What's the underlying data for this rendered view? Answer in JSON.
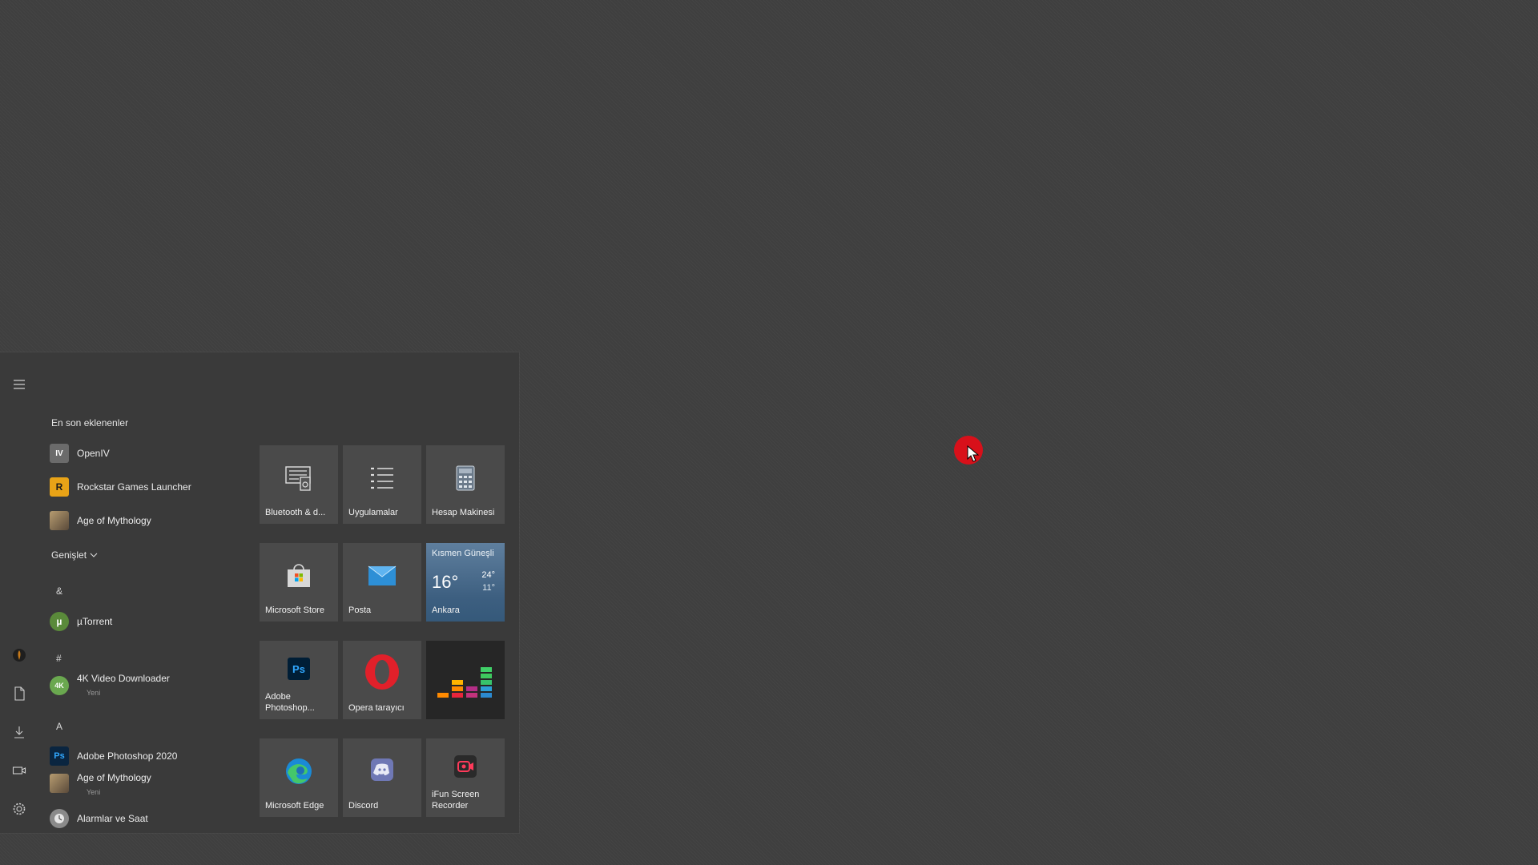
{
  "start_menu": {
    "recent_header": "En son eklenenler",
    "recent": [
      {
        "label": "OpenIV",
        "icon": "openiv-icon",
        "glyph": "IV",
        "color": "#6b6b6b"
      },
      {
        "label": "Rockstar Games Launcher",
        "icon": "rockstar-icon",
        "glyph": "R",
        "color": "#e8a317"
      },
      {
        "label": "Age of Mythology",
        "icon": "age-of-mythology-icon",
        "glyph": "",
        "color": "#8a7a60"
      }
    ],
    "expand_label": "Genişlet",
    "sections": [
      {
        "letter": "&",
        "apps": [
          {
            "label": "µTorrent",
            "sub": "",
            "icon": "utorrent-icon",
            "glyph": "µ",
            "color": "#5a8a3a"
          }
        ]
      },
      {
        "letter": "#",
        "apps": [
          {
            "label": "4K Video Downloader",
            "sub": "Yeni",
            "icon": "4k-video-downloader-icon",
            "glyph": "4K",
            "color": "#6aa84f"
          }
        ]
      },
      {
        "letter": "A",
        "apps": [
          {
            "label": "Adobe Photoshop 2020",
            "sub": "",
            "icon": "photoshop-icon",
            "glyph": "Ps",
            "color": "#0a2540"
          },
          {
            "label": "Age of Mythology",
            "sub": "Yeni",
            "icon": "age-of-mythology-icon",
            "glyph": "",
            "color": "#8a7a60"
          },
          {
            "label": "Alarmlar ve Saat",
            "sub": "",
            "icon": "alarm-clock-icon",
            "glyph": "",
            "color": "#7a7a7a"
          }
        ]
      }
    ],
    "tiles": [
      {
        "label": "Bluetooth & d...",
        "icon": "bluetooth-devices-icon"
      },
      {
        "label": "Uygulamalar",
        "icon": "apps-list-icon"
      },
      {
        "label": "Hesap Makinesi",
        "icon": "calculator-icon"
      },
      {
        "label": "Microsoft Store",
        "icon": "store-icon"
      },
      {
        "label": "Posta",
        "icon": "mail-icon"
      },
      {
        "label": "Ankara",
        "icon": "weather-icon"
      },
      {
        "label": "Adobe Photoshop...",
        "icon": "photoshop-icon"
      },
      {
        "label": "Opera tarayıcı",
        "icon": "opera-icon"
      },
      {
        "label": "",
        "icon": "deezer-icon"
      },
      {
        "label": "Microsoft Edge",
        "icon": "edge-icon"
      },
      {
        "label": "Discord",
        "icon": "discord-icon"
      },
      {
        "label": "iFun Screen Recorder",
        "icon": "screen-recorder-icon"
      }
    ],
    "weather": {
      "condition": "Kısmen Güneşli",
      "temp": "16°",
      "high": "24°",
      "low": "11°"
    }
  }
}
